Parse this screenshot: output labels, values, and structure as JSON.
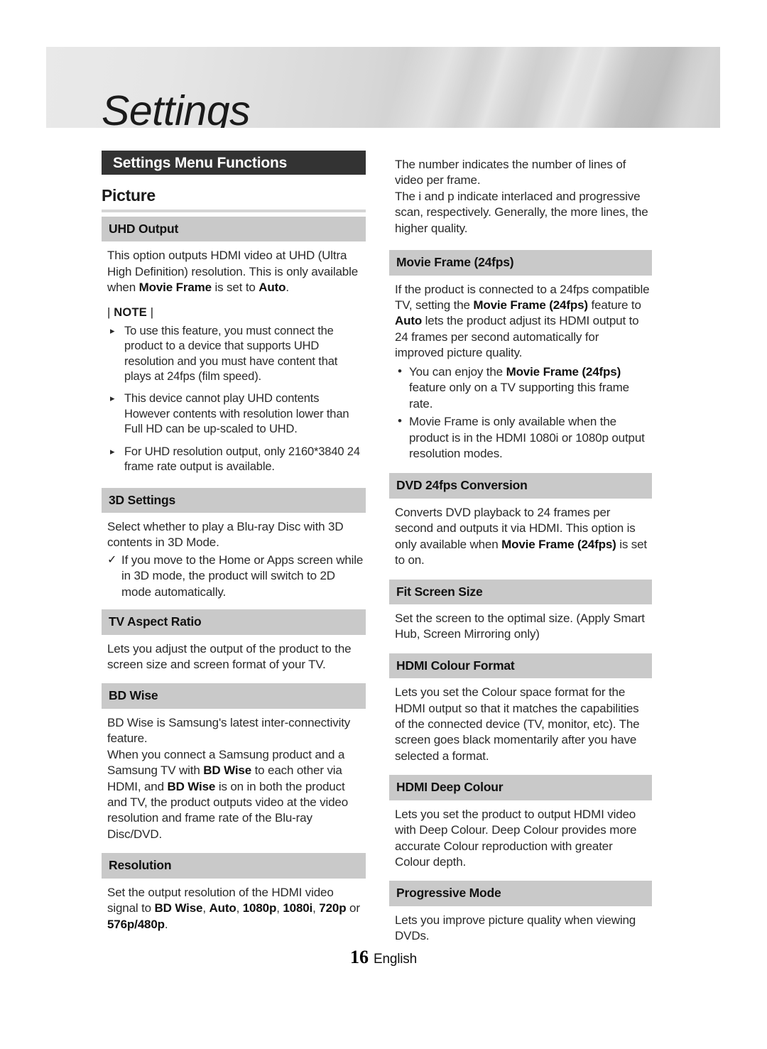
{
  "page": {
    "banner_title": "Settings",
    "section_bar_label": "Settings Menu Functions",
    "group_title": "Picture",
    "footer_page_number": "16",
    "footer_language": "English",
    "colors": {
      "section_bar_bg": "#333333",
      "subhead_bg": "#c9c9c9",
      "rule": "#d5d5d5",
      "text": "#2a2a2a"
    }
  },
  "left_column": {
    "uhd_output": {
      "heading": "UHD Output",
      "body_html": "This option outputs HDMI video at UHD (Ultra High Definition) resolution. This is only available when <b>Movie Frame</b> is set to <b>Auto</b>.",
      "note_label": "NOTE",
      "note_pipe": "|",
      "note_items": [
        "To use this feature, you must connect the product to a device that supports UHD resolution and you must have content that plays at 24fps (film speed).",
        "This device cannot play UHD contents However contents with resolution lower than Full HD can be up-scaled to UHD.",
        "For UHD resolution output, only 2160*3840 24 frame rate output is available."
      ]
    },
    "three_d_settings": {
      "heading": "3D Settings",
      "body_html": "Select whether to play a Blu-ray Disc with 3D contents in 3D Mode.",
      "check_item": "If you move to the Home or Apps screen while in 3D mode, the product will switch to 2D mode automatically."
    },
    "tv_aspect_ratio": {
      "heading": "TV Aspect Ratio",
      "body_html": "Lets you adjust the output of the product to the screen size and screen format of your TV."
    },
    "bd_wise": {
      "heading": "BD Wise",
      "body_html": "BD Wise is Samsung's latest inter-connectivity feature.<br>When you connect a Samsung product and a Samsung TV with <b>BD Wise</b> to each other via HDMI, and <b>BD Wise</b> is on in both the product and TV, the product outputs video at the video resolution and frame rate of the Blu-ray Disc/DVD."
    },
    "resolution": {
      "heading": "Resolution",
      "body_html": "Set the output resolution of the HDMI video signal to <b>BD Wise</b>, <b>Auto</b>, <b>1080p</b>, <b>1080i</b>, <b>720p</b> or <b>576p/480p</b>."
    }
  },
  "right_column": {
    "intro": {
      "body_html": "The number indicates the number of lines of video per frame.<br>The i and p indicate interlaced and progressive scan, respectively. Generally, the more lines, the higher quality."
    },
    "movie_frame": {
      "heading": "Movie Frame (24fps)",
      "body_html": "If the product is connected to a 24fps compatible TV, setting the <b>Movie Frame (24fps)</b> feature to <b>Auto</b> lets the product adjust its HDMI output to 24 frames per second automatically for improved picture quality.",
      "dot_items_html": [
        "You can enjoy the <b>Movie Frame (24fps)</b> feature only on a TV supporting this frame rate.",
        "Movie Frame is only available when the product is in the HDMI 1080i or 1080p output resolution modes."
      ]
    },
    "dvd_24fps_conversion": {
      "heading": "DVD 24fps Conversion",
      "body_html": "Converts DVD playback to 24 frames per second and outputs it via HDMI. This option is only available when <b>Movie Frame (24fps)</b> is set to on."
    },
    "fit_screen_size": {
      "heading": "Fit Screen Size",
      "body_html": "Set the screen to the optimal size. (Apply Smart Hub, Screen Mirroring only)"
    },
    "hdmi_colour_format": {
      "heading": "HDMI Colour Format",
      "body_html": "Lets you set the Colour space format for the HDMI output so that it matches the capabilities of the connected device (TV, monitor, etc). The screen goes black momentarily after you have selected a format."
    },
    "hdmi_deep_colour": {
      "heading": "HDMI Deep Colour",
      "body_html": "Lets you set the product to output HDMI video with Deep Colour. Deep Colour provides more accurate Colour reproduction with greater Colour depth."
    },
    "progressive_mode": {
      "heading": "Progressive Mode",
      "body_html": "Lets you improve picture quality when viewing DVDs."
    }
  },
  "icons": {
    "triangle_bullet": "▸",
    "check_bullet": "✓",
    "dot_bullet": "•"
  }
}
